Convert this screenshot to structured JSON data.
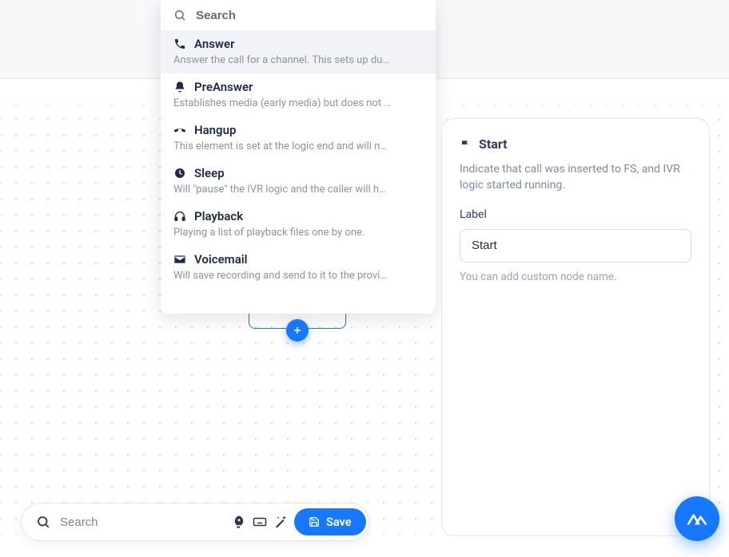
{
  "popover": {
    "search_placeholder": "Search",
    "items": [
      {
        "icon": "phone",
        "title": "Answer",
        "desc": "Answer the call for a channel. This sets up du…"
      },
      {
        "icon": "bell",
        "title": "PreAnswer",
        "desc": "Establishes media (early media) but does not …"
      },
      {
        "icon": "phone-end",
        "title": "Hangup",
        "desc": "This element is set at the logic end and will n…"
      },
      {
        "icon": "clock",
        "title": "Sleep",
        "desc": "Will \"pause\" the IVR logic and the caller will h…"
      },
      {
        "icon": "headphones",
        "title": "Playback",
        "desc": "Playing a list of playback files one by one."
      },
      {
        "icon": "envelope",
        "title": "Voicemail",
        "desc": "Will save recording and send to it to the provi…"
      }
    ]
  },
  "add_button_label": "+",
  "inspector": {
    "title": "Start",
    "description": "Indicate that call was inserted to FS, and IVR logic started running.",
    "field_label": "Label",
    "field_value": "Start",
    "hint": "You can add custom node name."
  },
  "toolbar": {
    "search_placeholder": "Search",
    "save_label": "Save"
  },
  "colors": {
    "accent": "#1677ff"
  }
}
